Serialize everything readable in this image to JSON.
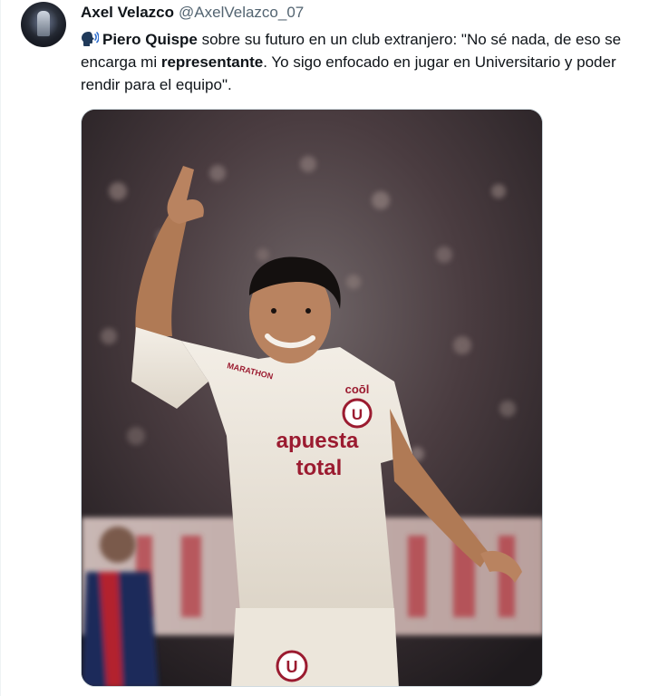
{
  "tweet": {
    "author_name": "Axel Velazco",
    "author_handle": "@AxelVelazco_07",
    "text_parts": {
      "p1": "Piero Quispe",
      "p2": " sobre su futuro en un club extranjero: \"No sé nada, de eso se encarga mi ",
      "p3": "representante",
      "p4": ". Yo sigo enfocado en jugar en Universitario y poder rendir para el equipo\"."
    },
    "icon": "speaking-head-icon"
  },
  "media": {
    "alt_subject": "player-celebrating-photo",
    "jersey_sponsor_line1": "apuesta",
    "jersey_sponsor_line2": "total",
    "jersey_brand": "coōl",
    "shoulder_brand": "MARATHON"
  },
  "colors": {
    "name": "#0f1419",
    "handle": "#536471",
    "border": "#cfd9de",
    "jersey": "#efe9de",
    "sponsor": "#9b1b30"
  }
}
